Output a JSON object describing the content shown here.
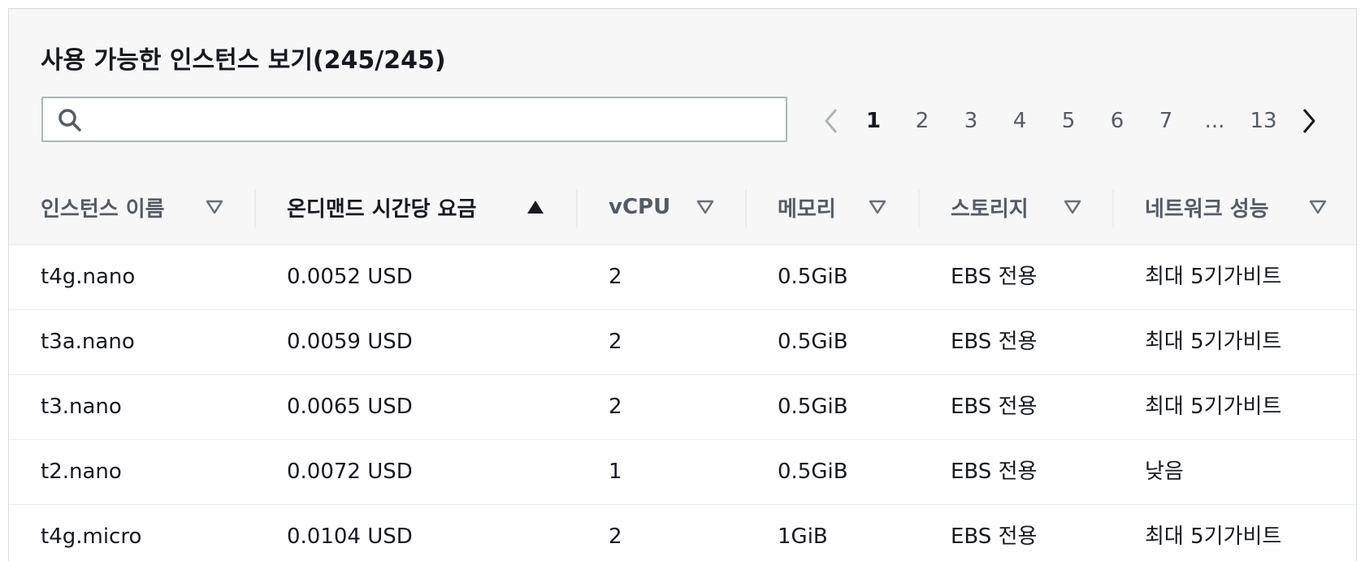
{
  "header": {
    "title": "사용 가능한 인스턴스 보기(245/245)",
    "search_placeholder": ""
  },
  "pagination": {
    "pages": [
      "1",
      "2",
      "3",
      "4",
      "5",
      "6",
      "7",
      "...",
      "13"
    ],
    "current": "1"
  },
  "table": {
    "columns": [
      "인스턴스 이름",
      "온디맨드 시간당 요금",
      "vCPU",
      "메모리",
      "스토리지",
      "네트워크 성능"
    ],
    "sorted_column": "온디맨드 시간당 요금",
    "sort_direction": "ascending",
    "rows": [
      [
        "t4g.nano",
        "0.0052 USD",
        "2",
        "0.5GiB",
        "EBS 전용",
        "최대 5기가비트"
      ],
      [
        "t3a.nano",
        "0.0059 USD",
        "2",
        "0.5GiB",
        "EBS 전용",
        "최대 5기가비트"
      ],
      [
        "t3.nano",
        "0.0065 USD",
        "2",
        "0.5GiB",
        "EBS 전용",
        "최대 5기가비트"
      ],
      [
        "t2.nano",
        "0.0072 USD",
        "1",
        "0.5GiB",
        "EBS 전용",
        "낮음"
      ],
      [
        "t4g.micro",
        "0.0104 USD",
        "2",
        "1GiB",
        "EBS 전용",
        "최대 5기가비트"
      ]
    ]
  },
  "colors": {
    "header_bg": "#f7f7f7",
    "text": "#16191f",
    "muted": "#545b64",
    "border": "#eaeded"
  },
  "icons": {
    "search": "search-icon",
    "prev": "chevron-left-icon",
    "next": "chevron-right-icon",
    "sort_asc": "caret-up-icon",
    "sortable": "caret-down-outline-icon"
  }
}
